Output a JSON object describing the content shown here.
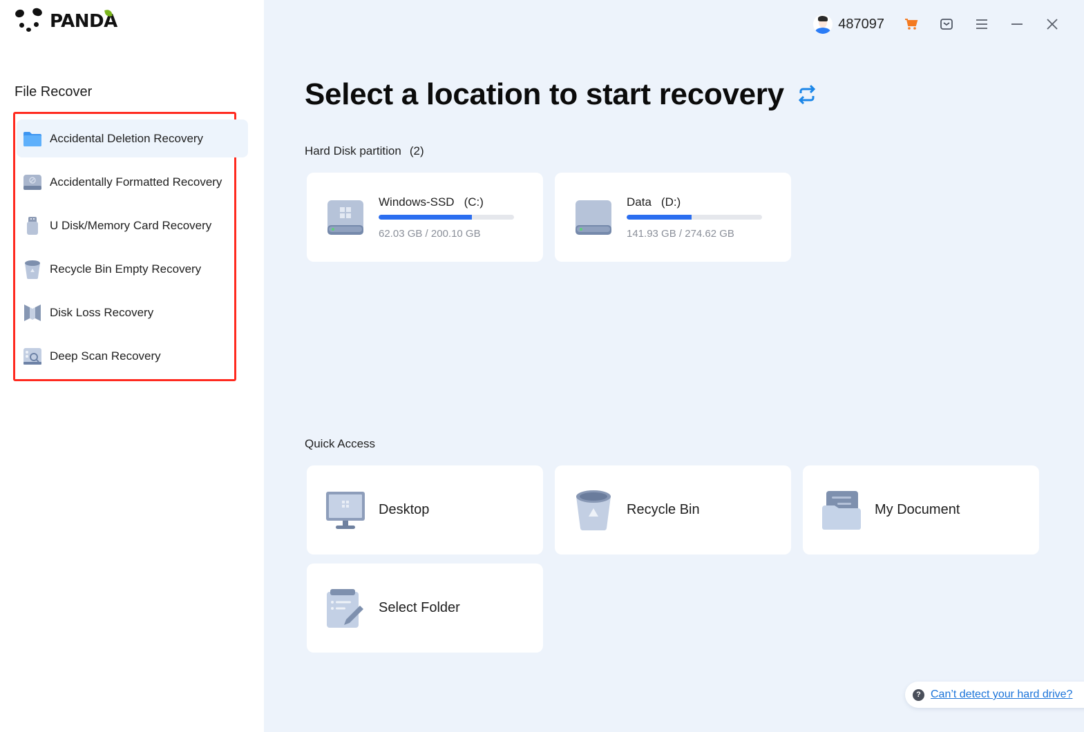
{
  "app": {
    "brand": "PANDA"
  },
  "sidebar": {
    "section_title": "File Recover",
    "items": [
      {
        "label": "Accidental Deletion Recovery",
        "icon": "folder-icon",
        "active": true
      },
      {
        "label": "Accidentally Formatted Recovery",
        "icon": "formatted-disk-icon",
        "active": false
      },
      {
        "label": "U Disk/Memory Card Recovery",
        "icon": "usb-drive-icon",
        "active": false
      },
      {
        "label": "Recycle Bin Empty Recovery",
        "icon": "recycle-bin-icon",
        "active": false
      },
      {
        "label": "Disk Loss Recovery",
        "icon": "disk-loss-icon",
        "active": false
      },
      {
        "label": "Deep Scan Recovery",
        "icon": "deep-scan-icon",
        "active": false
      }
    ]
  },
  "topbar": {
    "user_id": "487097",
    "icons": [
      "avatar",
      "cart-icon",
      "message-icon",
      "menu-icon",
      "minimize-icon",
      "close-icon"
    ]
  },
  "main": {
    "title": "Select a location to start recovery",
    "hard_disk": {
      "label": "Hard Disk partition",
      "count": "(2)",
      "partitions": [
        {
          "name": "Windows-SSD",
          "letter": "(C:)",
          "used": "62.03 GB",
          "total": "200.10 GB",
          "size_text": "62.03 GB / 200.10 GB",
          "usage_fraction": 0.69
        },
        {
          "name": "Data",
          "letter": "(D:)",
          "used": "141.93 GB",
          "total": "274.62 GB",
          "size_text": "141.93 GB / 274.62 GB",
          "usage_fraction": 0.48
        }
      ]
    },
    "quick_access": {
      "label": "Quick Access",
      "items": [
        {
          "label": "Desktop",
          "icon": "desktop-icon"
        },
        {
          "label": "Recycle Bin",
          "icon": "recycle-bin-icon"
        },
        {
          "label": "My Document",
          "icon": "document-folder-icon"
        },
        {
          "label": "Select Folder",
          "icon": "select-folder-icon"
        }
      ]
    },
    "help_link": "Can’t detect your hard drive?"
  },
  "colors": {
    "accent": "#2b6ef0",
    "cart": "#f47a20",
    "highlight_frame": "#ff2a1f",
    "link": "#1a73d9",
    "main_bg": "#edf3fb"
  }
}
